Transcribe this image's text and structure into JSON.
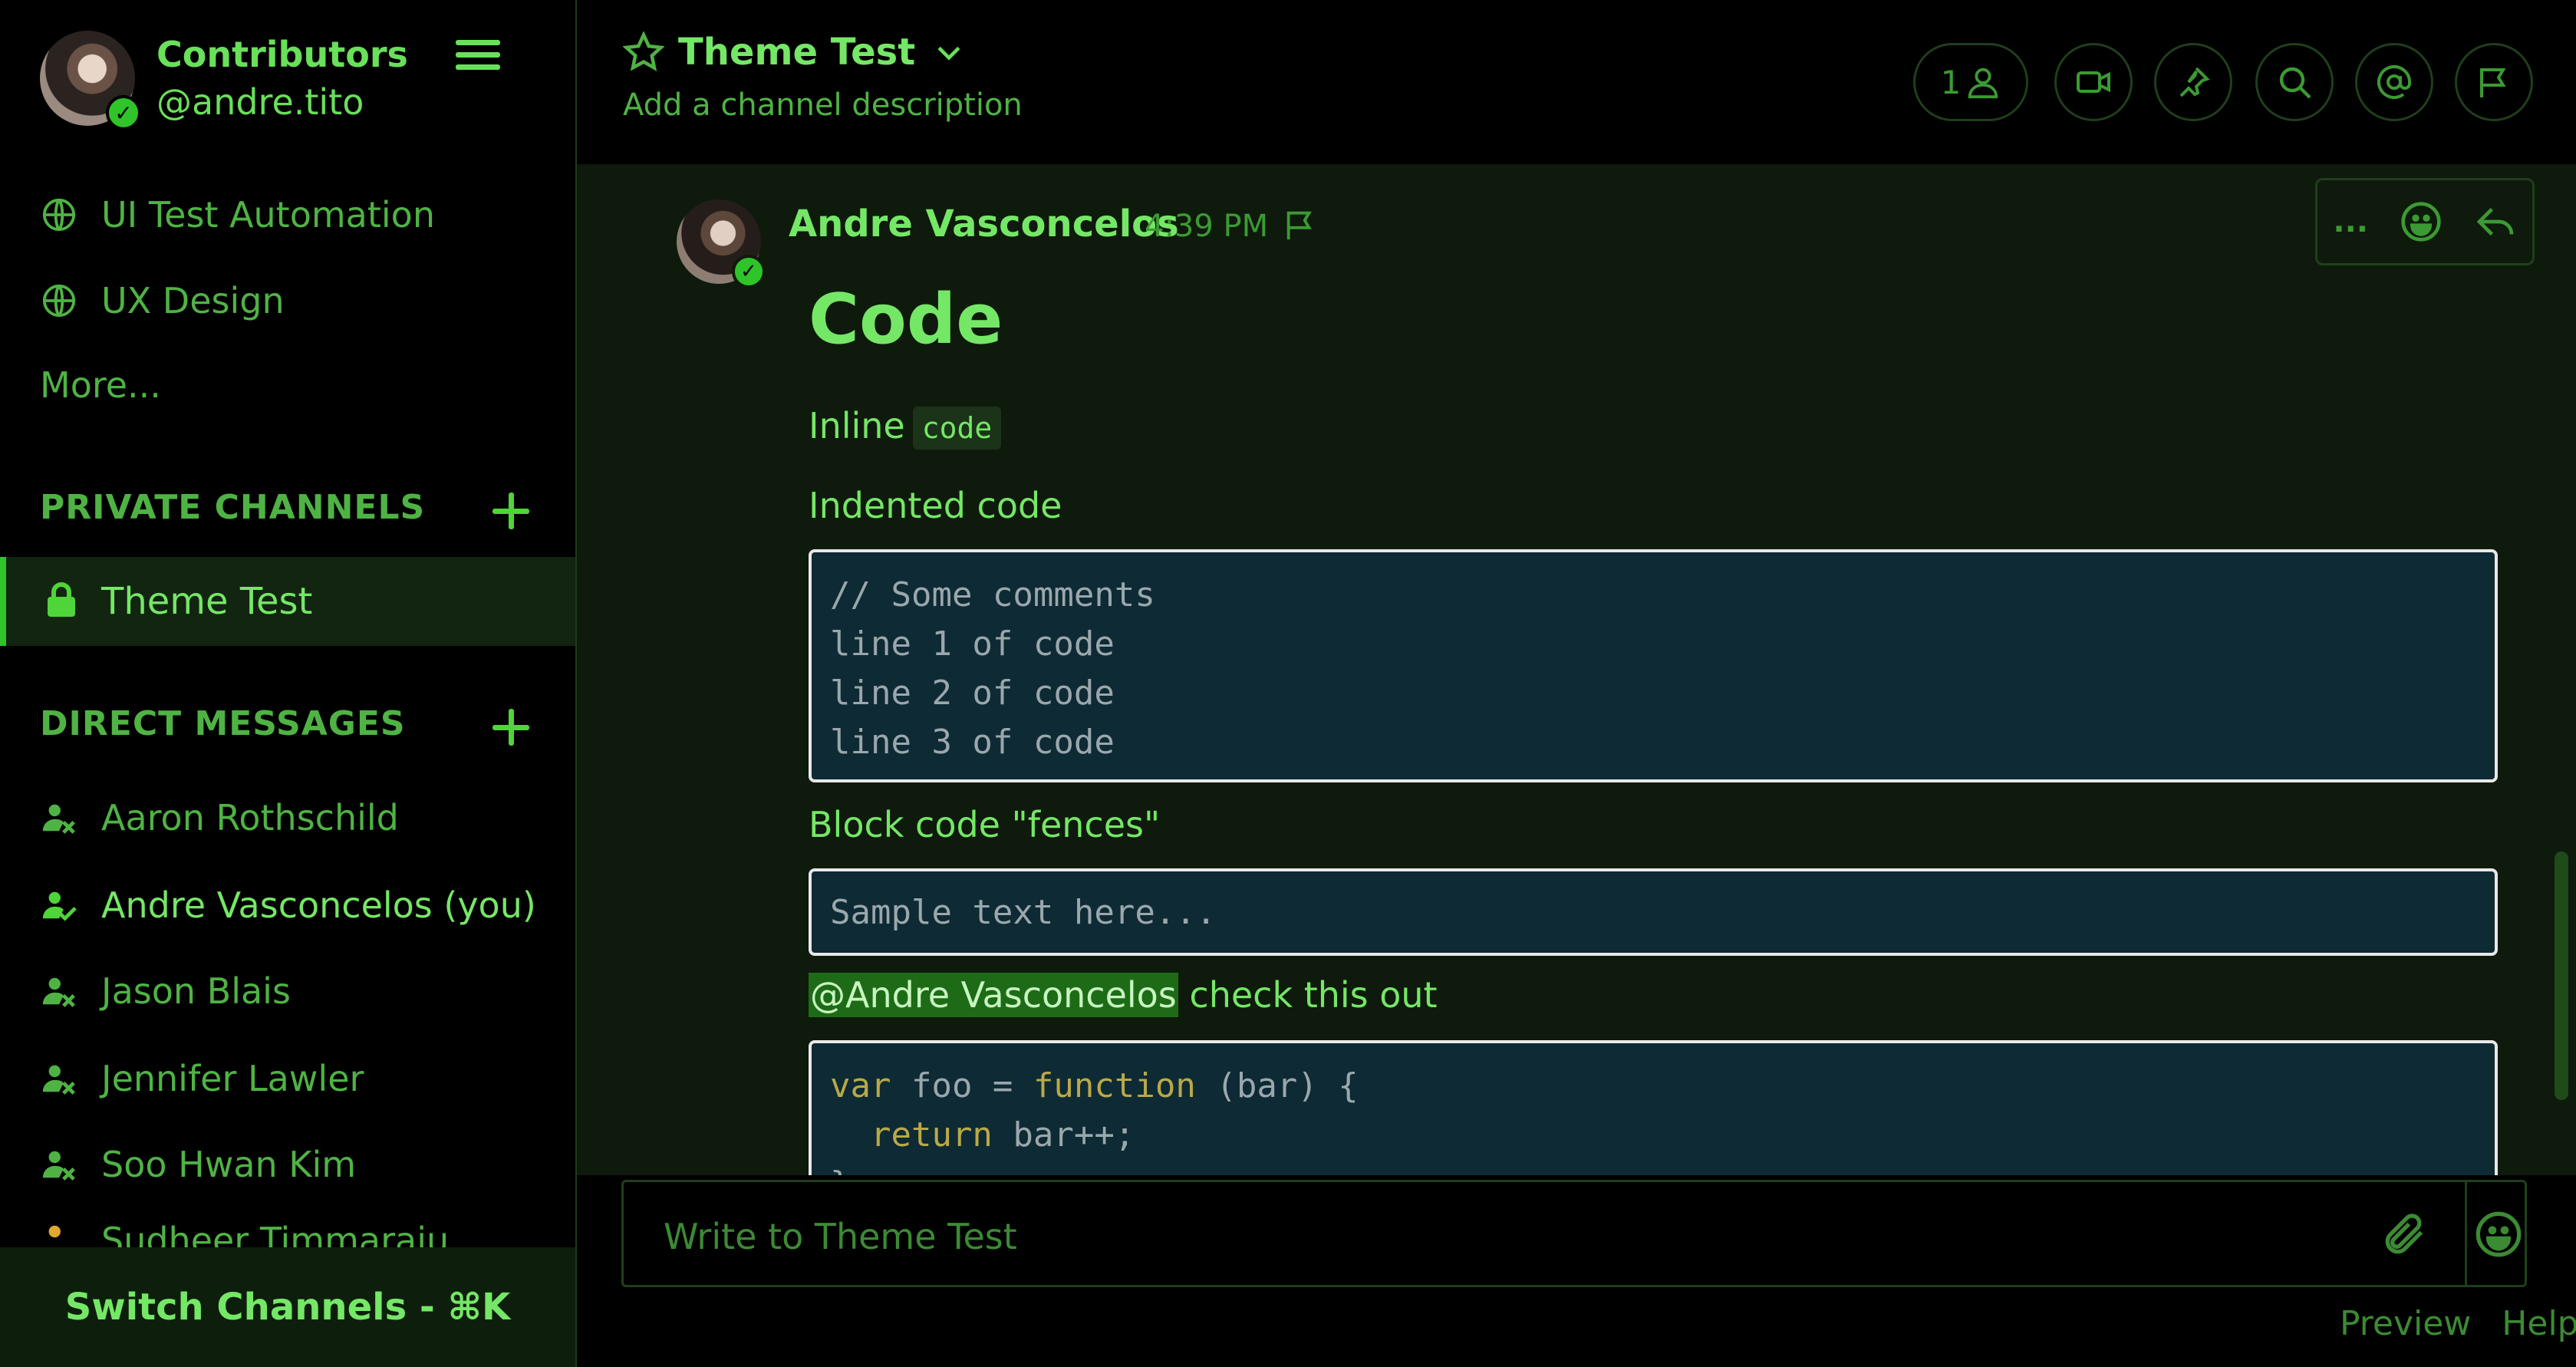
{
  "team": {
    "name": "Contributors",
    "username": "@andre.tito"
  },
  "public_channels": [
    {
      "label": "UI Test Automation"
    },
    {
      "label": "UX Design"
    }
  ],
  "more_label": "More...",
  "private_section": {
    "title": "PRIVATE CHANNELS",
    "items": [
      {
        "label": "Theme Test",
        "active": true
      }
    ]
  },
  "direct_section": {
    "title": "DIRECT MESSAGES",
    "items": [
      {
        "label": "Aaron Rothschild",
        "status": "offline"
      },
      {
        "label": "Andre Vasconcelos (you)",
        "status": "online"
      },
      {
        "label": "Jason Blais",
        "status": "offline"
      },
      {
        "label": "Jennifer Lawler",
        "status": "offline"
      },
      {
        "label": "Soo Hwan Kim",
        "status": "offline"
      },
      {
        "label": "Sudheer Timmaraju",
        "status": "away"
      }
    ]
  },
  "switch_channels": "Switch Channels - ⌘K",
  "channel": {
    "title": "Theme Test",
    "description": "Add a channel description",
    "member_count": "1"
  },
  "message": {
    "author": "Andre Vasconcelos",
    "time": "4:39 PM",
    "heading": "Code",
    "inline_label": "Inline",
    "inline_code": "code",
    "indented_label": "Indented code",
    "indented_lines": [
      "// Some comments",
      "line 1 of code",
      "line 2 of code",
      "line 3 of code"
    ],
    "fences_label": "Block code \"fences\"",
    "fences_text": "Sample text here...",
    "mention": "@Andre Vasconcelos",
    "mention_rest": " check this out",
    "js_line1": {
      "kw1": "var",
      "mid": " foo = ",
      "kw2": "function",
      "end": " (bar) {"
    },
    "js_line2": {
      "indent": "  ",
      "kw": "return",
      "end": " bar++;"
    },
    "js_line3": "}",
    "actions_dots": "..."
  },
  "composer": {
    "placeholder": "Write to Theme Test"
  },
  "footer": {
    "preview": "Preview",
    "help": "Help"
  },
  "colors": {
    "accent": "#69e05a",
    "online": "#2fc42a",
    "away": "#e0a82e",
    "code_bg": "#0e2a34",
    "mention_bg": "#1e6b17"
  }
}
